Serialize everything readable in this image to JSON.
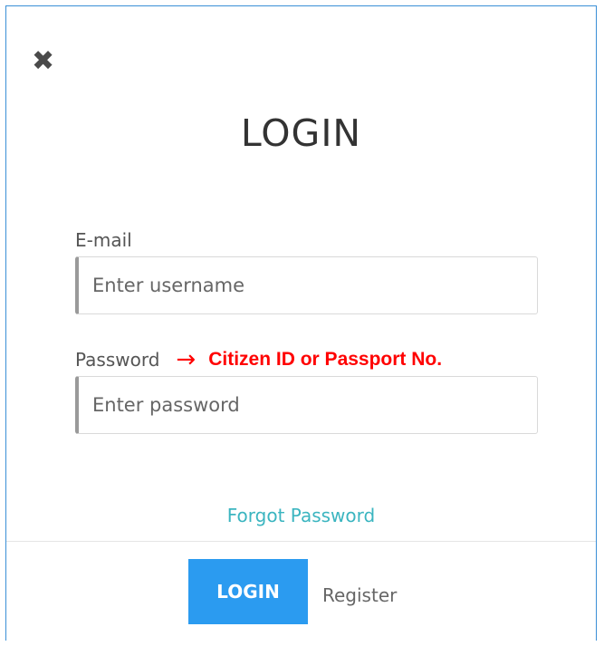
{
  "modal": {
    "close_icon": "close-icon",
    "title": "LOGIN",
    "email": {
      "label": "E-mail",
      "placeholder": "Enter username"
    },
    "password": {
      "label": "Password",
      "arrow": "→",
      "note": "Citizen ID or Passport No.",
      "placeholder": "Enter password"
    },
    "forgot_link": "Forgot Password",
    "login_button": "LOGIN",
    "register_link": "Register",
    "colors": {
      "accent": "#2b9bf0",
      "link": "#3bb5c0",
      "annotation": "#ff0000"
    }
  }
}
